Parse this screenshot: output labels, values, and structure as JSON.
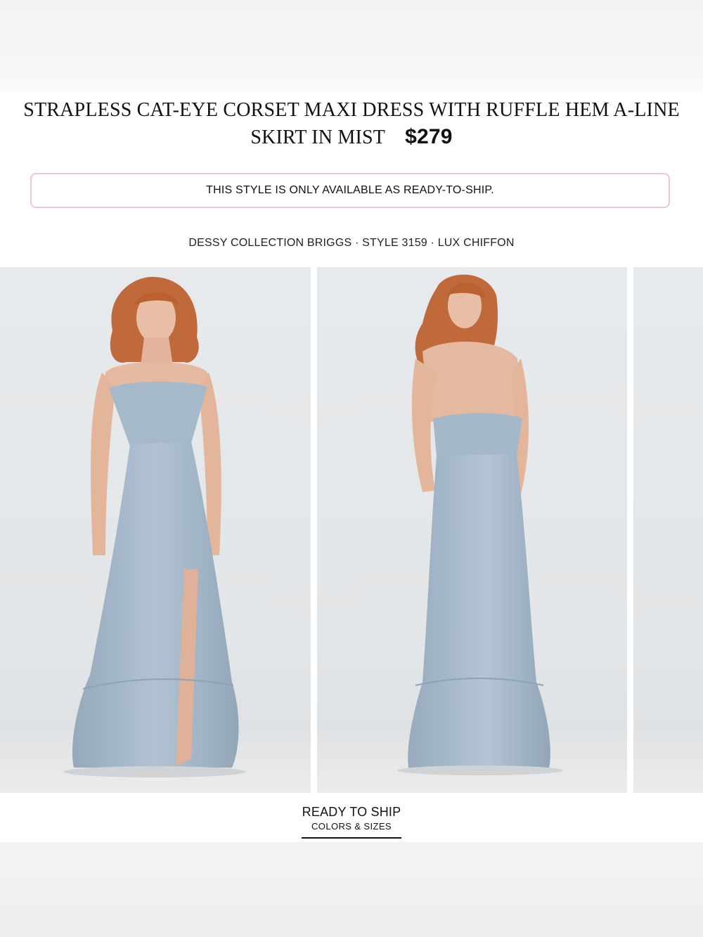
{
  "product": {
    "title": "STRAPLESS CAT-EYE CORSET MAXI DRESS WITH RUFFLE HEM A-LINE SKIRT IN MIST",
    "price": "$279",
    "notice": "THIS STYLE IS ONLY AVAILABLE AS READY-TO-SHIP.",
    "meta": "DESSY COLLECTION BRIGGS · STYLE 3159 · LUX CHIFFON"
  },
  "gallery": {
    "images": [
      {
        "view": "front"
      },
      {
        "view": "back"
      },
      {
        "view": "partial"
      }
    ]
  },
  "tabs": {
    "active": {
      "title": "READY TO SHIP",
      "subtitle": "COLORS & SIZES"
    }
  },
  "colors": {
    "notice_border": "#f1c3d3",
    "dress_mist": "#a9bccd",
    "background": "#ffffff"
  }
}
